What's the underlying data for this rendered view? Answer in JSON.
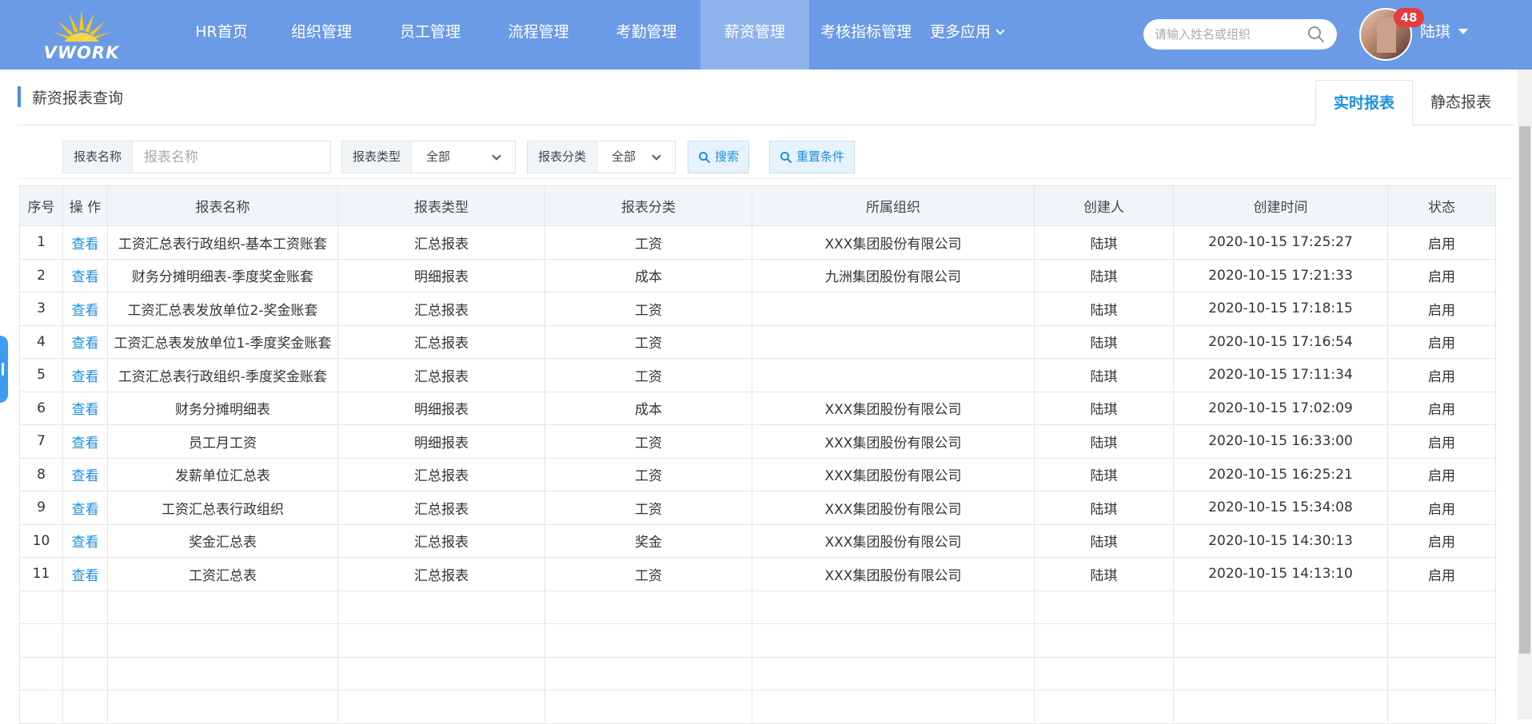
{
  "header": {
    "logo_text": "VWORK",
    "nav": [
      {
        "label": "HR首页"
      },
      {
        "label": "组织管理"
      },
      {
        "label": "员工管理"
      },
      {
        "label": "流程管理"
      },
      {
        "label": "考勤管理"
      },
      {
        "label": "薪资管理",
        "active": true
      },
      {
        "label": "考核指标管理"
      },
      {
        "label": "更多应用",
        "dropdown": true
      }
    ],
    "search_placeholder": "请输入姓名或组织",
    "badge_count": "48",
    "user_name": "陆琪",
    "colors": {
      "topbar": "#6b9be6",
      "active_nav": "#8fb3ec",
      "badge": "#e73b3b"
    }
  },
  "page": {
    "title": "薪资报表查询",
    "tabs": [
      {
        "label": "实时报表",
        "active": true
      },
      {
        "label": "静态报表"
      }
    ]
  },
  "filters": {
    "name_label": "报表名称",
    "name_placeholder": "报表名称",
    "type_label": "报表类型",
    "type_value": "全部",
    "category_label": "报表分类",
    "category_value": "全部",
    "search_button": "搜索",
    "reset_button": "重置条件"
  },
  "table": {
    "columns": [
      "序号",
      "操 作",
      "报表名称",
      "报表类型",
      "报表分类",
      "所属组织",
      "创建人",
      "创建时间",
      "状态"
    ],
    "rows": [
      [
        "1",
        "查看",
        "工资汇总表行政组织-基本工资账套",
        "汇总报表",
        "工资",
        "XXX集团股份有限公司",
        "陆琪",
        "2020-10-15 17:25:27",
        "启用"
      ],
      [
        "2",
        "查看",
        "财务分摊明细表-季度奖金账套",
        "明细报表",
        "成本",
        "九洲集团股份有限公司",
        "陆琪",
        "2020-10-15 17:21:33",
        "启用"
      ],
      [
        "3",
        "查看",
        "工资汇总表发放单位2-奖金账套",
        "汇总报表",
        "工资",
        "",
        "陆琪",
        "2020-10-15 17:18:15",
        "启用"
      ],
      [
        "4",
        "查看",
        "工资汇总表发放单位1-季度奖金账套",
        "汇总报表",
        "工资",
        "",
        "陆琪",
        "2020-10-15 17:16:54",
        "启用"
      ],
      [
        "5",
        "查看",
        "工资汇总表行政组织-季度奖金账套",
        "汇总报表",
        "工资",
        "",
        "陆琪",
        "2020-10-15 17:11:34",
        "启用"
      ],
      [
        "6",
        "查看",
        "财务分摊明细表",
        "明细报表",
        "成本",
        "XXX集团股份有限公司",
        "陆琪",
        "2020-10-15 17:02:09",
        "启用"
      ],
      [
        "7",
        "查看",
        "员工月工资",
        "明细报表",
        "工资",
        "XXX集团股份有限公司",
        "陆琪",
        "2020-10-15 16:33:00",
        "启用"
      ],
      [
        "8",
        "查看",
        "发薪单位汇总表",
        "汇总报表",
        "工资",
        "XXX集团股份有限公司",
        "陆琪",
        "2020-10-15 16:25:21",
        "启用"
      ],
      [
        "9",
        "查看",
        "工资汇总表行政组织",
        "汇总报表",
        "工资",
        "XXX集团股份有限公司",
        "陆琪",
        "2020-10-15 15:34:08",
        "启用"
      ],
      [
        "10",
        "查看",
        "奖金汇总表",
        "汇总报表",
        "奖金",
        "XXX集团股份有限公司",
        "陆琪",
        "2020-10-15 14:30:13",
        "启用"
      ],
      [
        "11",
        "查看",
        "工资汇总表",
        "汇总报表",
        "工资",
        "XXX集团股份有限公司",
        "陆琪",
        "2020-10-15 14:13:10",
        "启用"
      ]
    ],
    "empty_rows": 4
  }
}
